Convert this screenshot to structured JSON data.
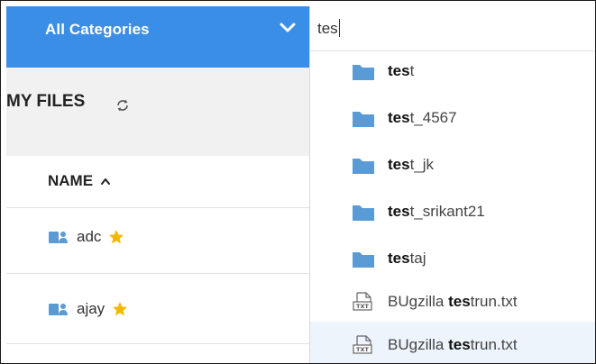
{
  "left_panel": {
    "category_dropdown": {
      "label": "All Categories"
    },
    "section_title": "MY FILES",
    "column_header": "NAME",
    "files": [
      {
        "name": "adc",
        "starred": true
      },
      {
        "name": "ajay",
        "starred": true
      }
    ]
  },
  "search": {
    "query": "tes",
    "results": [
      {
        "match": "tes",
        "rest": "t",
        "type": "folder"
      },
      {
        "match": "tes",
        "rest": "t_4567",
        "type": "folder"
      },
      {
        "match": "tes",
        "rest": "t_jk",
        "type": "folder"
      },
      {
        "match": "tes",
        "rest": "t_srikant21",
        "type": "folder"
      },
      {
        "match": "tes",
        "rest": "taj",
        "type": "folder"
      },
      {
        "prefix": "BUgzilla ",
        "match": "tes",
        "rest": "trun.txt",
        "type": "txt-file"
      },
      {
        "prefix": "BUgzilla ",
        "match": "tes",
        "rest": "trun.txt",
        "type": "txt-file"
      }
    ]
  },
  "colors": {
    "accent_blue": "#3a8ee6",
    "folder_blue": "#5b9bd5",
    "star_yellow": "#f5b800",
    "hover_bg": "#eef4fb"
  }
}
